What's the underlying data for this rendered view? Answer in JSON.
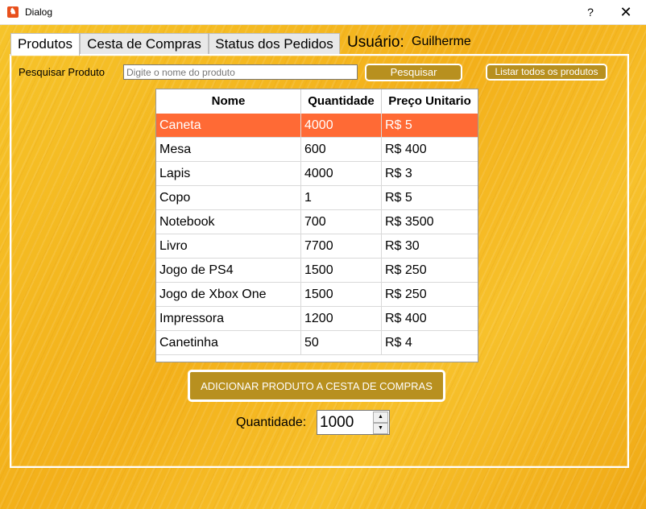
{
  "window": {
    "title": "Dialog",
    "help_label": "?",
    "close_label": "✕",
    "icon": "app-icon"
  },
  "tabs": [
    {
      "label": "Produtos",
      "active": true
    },
    {
      "label": "Cesta de Compras",
      "active": false
    },
    {
      "label": "Status dos Pedidos",
      "active": false
    }
  ],
  "user": {
    "label": "Usuário:",
    "name": "Guilherme"
  },
  "search": {
    "label": "Pesquisar Produto",
    "placeholder": "Digite o nome do produto",
    "value": "",
    "search_button": "Pesquisar",
    "list_all_button": "Listar todos os produtos"
  },
  "table": {
    "columns": [
      "Nome",
      "Quantidade",
      "Preço Unitario"
    ],
    "selected_row": 0,
    "rows": [
      [
        "Caneta",
        "4000",
        "R$ 5"
      ],
      [
        "Mesa",
        "600",
        "R$ 400"
      ],
      [
        "Lapis",
        "4000",
        "R$ 3"
      ],
      [
        "Copo",
        "1",
        "R$ 5"
      ],
      [
        "Notebook",
        "700",
        "R$ 3500"
      ],
      [
        "Livro",
        "7700",
        "R$ 30"
      ],
      [
        "Jogo de PS4",
        "1500",
        "R$ 250"
      ],
      [
        "Jogo de Xbox One",
        "1500",
        "R$ 250"
      ],
      [
        "Impressora",
        "1200",
        "R$ 400"
      ],
      [
        "Canetinha",
        "50",
        "R$ 4"
      ]
    ]
  },
  "add_button": "ADICIONAR PRODUTO A CESTA DE COMPRAS",
  "quantity": {
    "label": "Quantidade:",
    "value": "1000",
    "up_arrow": "▲",
    "down_arrow": "▼"
  },
  "colors": {
    "selected_row": "#ff6a35",
    "button_bg": "#b8901f",
    "background": "#f2b418"
  }
}
